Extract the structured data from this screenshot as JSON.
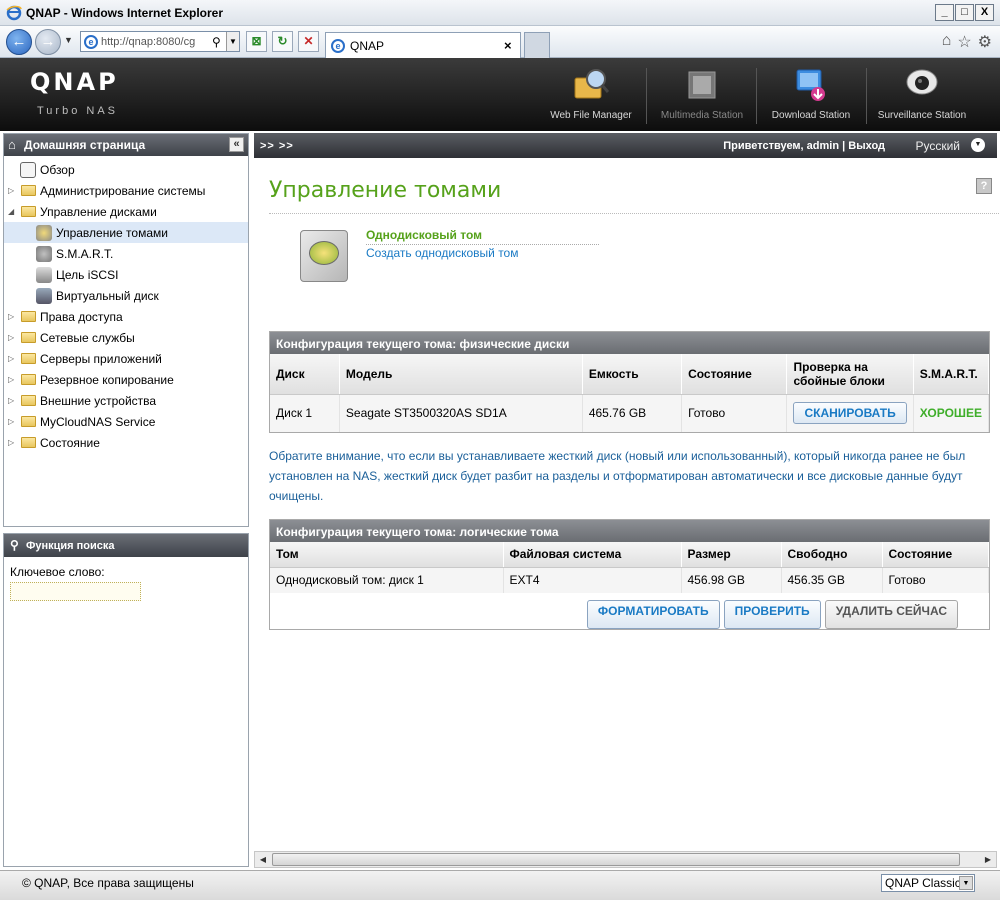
{
  "window": {
    "title": "QNAP - Windows Internet Explorer",
    "minimize": "_",
    "maximize": "□",
    "close": "X"
  },
  "browser": {
    "url": "http://qnap:8080/cg",
    "tab_title": "QNAP",
    "tab_close": "×"
  },
  "header": {
    "logo": "QNAP",
    "sublogo": "Turbo NAS",
    "apps": [
      {
        "label": "Web File Manager",
        "icon": "folder-magnifier-icon"
      },
      {
        "label": "Multimedia Station",
        "icon": "film-icon"
      },
      {
        "label": "Download Station",
        "icon": "download-icon"
      },
      {
        "label": "Surveillance Station",
        "icon": "camera-icon"
      }
    ]
  },
  "sidebar": {
    "title": "Домашняя страница",
    "items": [
      {
        "label": "Обзор"
      },
      {
        "label": "Администрирование системы"
      },
      {
        "label": "Управление дисками"
      },
      {
        "label": "Управление томами"
      },
      {
        "label": "S.M.A.R.T."
      },
      {
        "label": "Цель iSCSI"
      },
      {
        "label": "Виртуальный диск"
      },
      {
        "label": "Права доступа"
      },
      {
        "label": "Сетевые службы"
      },
      {
        "label": "Серверы приложений"
      },
      {
        "label": "Резервное копирование"
      },
      {
        "label": "Внешние устройства"
      },
      {
        "label": "MyCloudNAS Service"
      },
      {
        "label": "Состояние"
      }
    ]
  },
  "search": {
    "title": "Функция поиска",
    "label": "Ключевое слово:",
    "value": ""
  },
  "topbar": {
    "arrows": ">> >>",
    "greeting": "Приветствуем, admin | Выход",
    "language": "Русский"
  },
  "main": {
    "title": "Управление томами",
    "help": "?",
    "volume_type": "Однодисковый том",
    "create_link": "Создать однодисковый том",
    "physical": {
      "title": "Конфигурация текущего тома: физические диски",
      "headers": [
        "Диск",
        "Модель",
        "Емкость",
        "Состояние",
        "Проверка на сбойные блоки",
        "S.M.A.R.T."
      ],
      "rows": [
        {
          "disk": "Диск 1",
          "model": "Seagate ST3500320AS SD1A",
          "capacity": "465.76 GB",
          "status": "Готово",
          "scan": "СКАНИРОВАТЬ",
          "smart": "ХОРОШЕЕ"
        }
      ]
    },
    "note": "Обратите внимание, что если вы устанавливаете жесткий диск (новый или использованный), который никогда ранее не был установлен на NAS, жесткий диск будет разбит на разделы и отформатирован автоматически и все дисковые данные будут очищены.",
    "logical": {
      "title": "Конфигурация текущего тома: логические тома",
      "headers": [
        "Том",
        "Файловая система",
        "Размер",
        "Свободно",
        "Состояние"
      ],
      "rows": [
        {
          "volume": "Однодисковый том: диск 1",
          "fs": "EXT4",
          "size": "456.98 GB",
          "free": "456.35 GB",
          "status": "Готово"
        }
      ],
      "buttons": [
        "ФОРМАТИРОВАТЬ",
        "ПРОВЕРИТЬ",
        "УДАЛИТЬ СЕЙЧАС"
      ]
    }
  },
  "footer": {
    "copyright": "© QNAP, Все права защищены",
    "theme": "QNAP Classic"
  },
  "colors": {
    "accent_green": "#56a21b",
    "link_blue": "#1a7ac4",
    "header_dark": "#1a1a1a"
  }
}
